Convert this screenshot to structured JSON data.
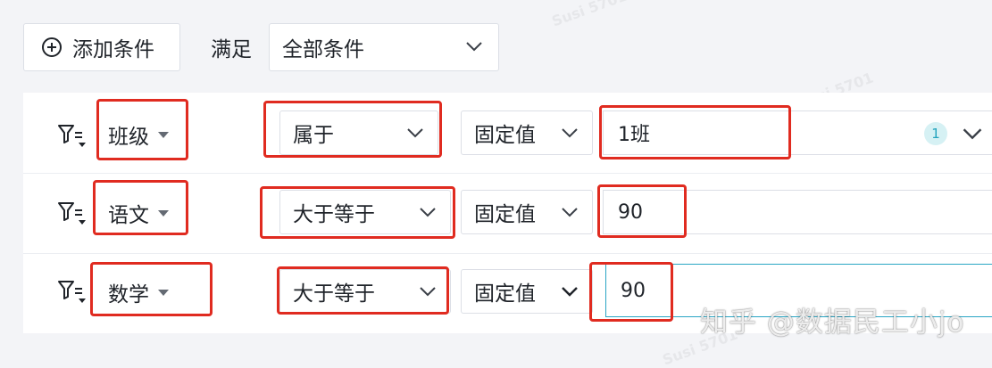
{
  "toolbar": {
    "add_condition_label": "添加条件",
    "satisfy_label": "满足",
    "match_mode": "全部条件"
  },
  "conditions": [
    {
      "field": "班级",
      "operator": "属于",
      "value_type": "固定值",
      "value": "1班",
      "selected_count": "1"
    },
    {
      "field": "语文",
      "operator": "大于等于",
      "value_type": "固定值",
      "value": "90"
    },
    {
      "field": "数学",
      "operator": "大于等于",
      "value_type": "固定值",
      "value": "90"
    }
  ],
  "watermark": "知乎 @数据民工小jo",
  "background_marks": [
    "Susi 5701",
    "Susi 5701",
    "Susi 5701"
  ],
  "colors": {
    "highlight": "#e02b20",
    "accent": "#2aa6c4",
    "badge_bg": "#d6f1f4"
  },
  "icons": {
    "add": "plus-circle-icon",
    "filter": "filter-icon",
    "dropdown": "chevron-down-icon",
    "field_menu": "caret-down-icon"
  }
}
